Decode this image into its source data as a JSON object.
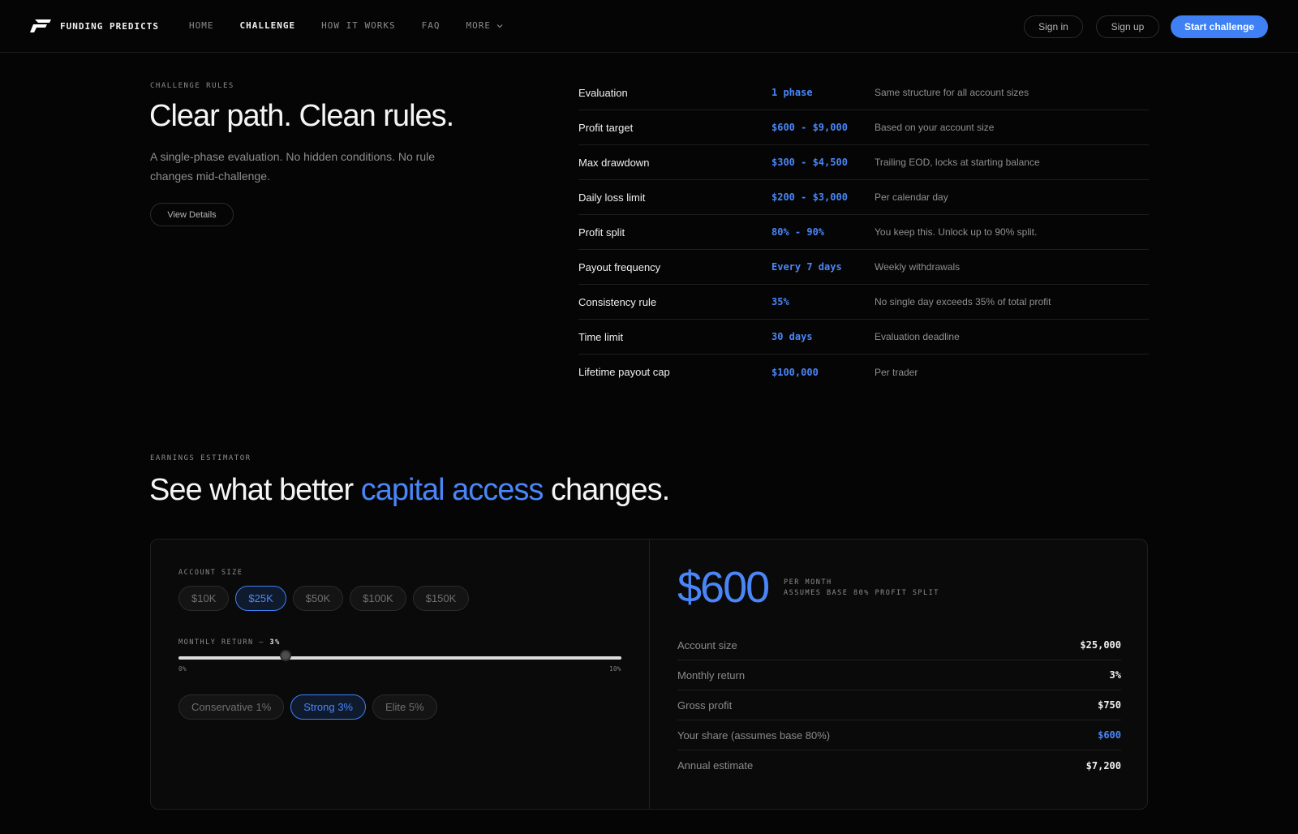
{
  "nav": {
    "brand": "FUNDING PREDICTS",
    "links": [
      {
        "label": "HOME"
      },
      {
        "label": "CHALLENGE"
      },
      {
        "label": "HOW IT WORKS"
      },
      {
        "label": "FAQ"
      },
      {
        "label": "MORE"
      }
    ],
    "sign_in": "Sign in",
    "sign_up": "Sign up",
    "start": "Start challenge",
    "accent_color": "#3f80f5"
  },
  "rules_section": {
    "eyebrow": "CHALLENGE RULES",
    "title": "Clear path. Clean rules.",
    "lead": "A single-phase evaluation. No hidden conditions. No rule changes mid-challenge.",
    "details_button": "View Details",
    "rows": [
      {
        "name": "Evaluation",
        "value": "1 phase",
        "desc": "Same structure for all account sizes"
      },
      {
        "name": "Profit target",
        "value": "$600 - $9,000",
        "desc": "Based on your account size"
      },
      {
        "name": "Max drawdown",
        "value": "$300 - $4,500",
        "desc": "Trailing EOD, locks at starting balance"
      },
      {
        "name": "Daily loss limit",
        "value": "$200 - $3,000",
        "desc": "Per calendar day"
      },
      {
        "name": "Profit split",
        "value": "80% - 90%",
        "desc": "You keep this. Unlock up to 90% split."
      },
      {
        "name": "Payout frequency",
        "value": "Every 7 days",
        "desc": "Weekly withdrawals"
      },
      {
        "name": "Consistency rule",
        "value": "35%",
        "desc": "No single day exceeds 35% of total profit"
      },
      {
        "name": "Time limit",
        "value": "30 days",
        "desc": "Evaluation deadline"
      },
      {
        "name": "Lifetime payout cap",
        "value": "$100,000",
        "desc": "Per trader"
      }
    ]
  },
  "estimator": {
    "eyebrow": "EARNINGS ESTIMATOR",
    "title_pre": "See what better ",
    "title_accent": "capital access",
    "title_post": " changes.",
    "account_size_label": "ACCOUNT SIZE",
    "account_sizes": [
      "$10K",
      "$25K",
      "$50K",
      "$100K",
      "$150K"
    ],
    "selected_account_size": "$25K",
    "monthly_return_label": "MONTHLY RETURN — ",
    "monthly_return_value": "3%",
    "slider_min": "0%",
    "slider_max": "10%",
    "slider_value_pct": 3,
    "presets": [
      "Conservative 1%",
      "Strong 3%",
      "Elite 5%"
    ],
    "selected_preset": "Strong 3%",
    "result_value": "$600",
    "result_meta_1": "PER MONTH",
    "result_meta_2": "ASSUMES BASE 80% PROFIT SPLIT",
    "summary": [
      {
        "label": "Account size",
        "value": "$25,000"
      },
      {
        "label": "Monthly return",
        "value": "3%"
      },
      {
        "label": "Gross profit",
        "value": "$750"
      },
      {
        "label": "Your share (assumes base 80%)",
        "value": "$600"
      },
      {
        "label": "Annual estimate",
        "value": "$7,200"
      }
    ]
  }
}
